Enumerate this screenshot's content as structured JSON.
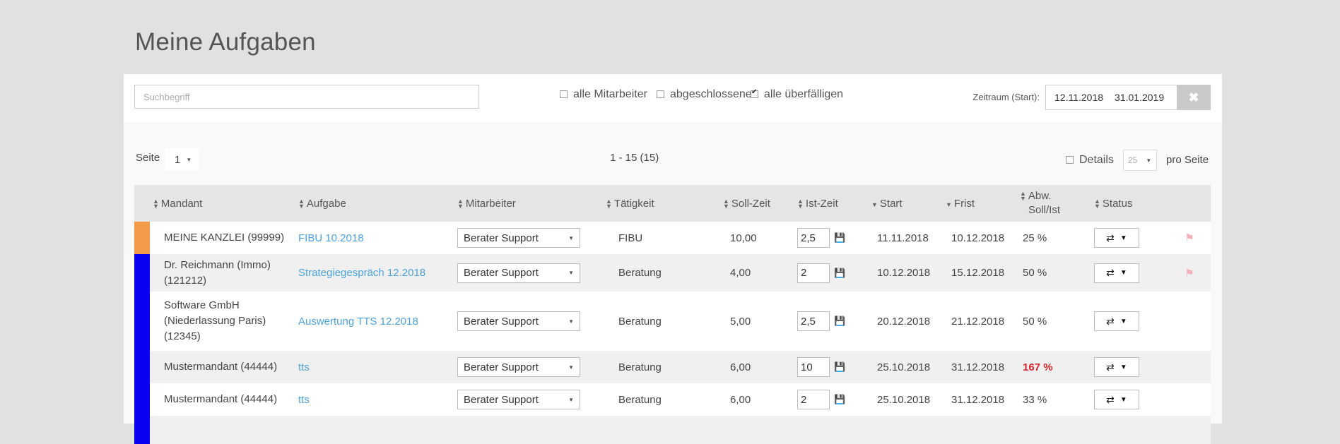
{
  "page": {
    "title": "Meine Aufgaben"
  },
  "filter": {
    "search_placeholder": "Suchbegriff",
    "checkboxes": [
      {
        "label": "alle Mitarbeiter",
        "checked": false
      },
      {
        "label": "abgeschlossene",
        "checked": false
      },
      {
        "label": "alle überfälligen",
        "checked": true
      }
    ],
    "zeitraum_label": "Zeitraum (Start):",
    "date_start": "12.11.2018",
    "date_end": "31.01.2019",
    "clear_icon": "close-icon"
  },
  "pager": {
    "seite_label": "Seite",
    "page": "1",
    "range": "1 - 15 (15)",
    "details_label": "Details",
    "per_page": "25",
    "per_page_label": "pro Seite"
  },
  "table": {
    "headers": {
      "mandant": "Mandant",
      "aufgabe": "Aufgabe",
      "mitarbeiter": "Mitarbeiter",
      "taetigkeit": "Tätigkeit",
      "soll": "Soll-Zeit",
      "ist": "Ist-Zeit",
      "start": "Start",
      "frist": "Frist",
      "abw_line1": "Abw.",
      "abw_line2": "Soll/Ist",
      "status": "Status"
    },
    "rows": [
      {
        "color": "#f59a48",
        "mandant_lines": [
          "MEINE KANZLEI (99999)"
        ],
        "aufgabe": "FIBU 10.2018",
        "mitarbeiter": "Berater Support",
        "taetigkeit": "FIBU",
        "soll": "10,00",
        "ist": "2,5",
        "start": "11.11.2018",
        "frist": "10.12.2018",
        "abw": "25 %",
        "abw_over": false,
        "flag": true
      },
      {
        "color": "#0a00f0",
        "mandant_lines": [
          "Dr. Reichmann (Immo)",
          "(121212)"
        ],
        "aufgabe": "Strategiegespräch 12.2018",
        "mitarbeiter": "Berater Support",
        "taetigkeit": "Beratung",
        "soll": "4,00",
        "ist": "2",
        "start": "10.12.2018",
        "frist": "15.12.2018",
        "abw": "50 %",
        "abw_over": false,
        "flag": true
      },
      {
        "color": "#0a00f0",
        "mandant_lines": [
          "Software GmbH",
          "(Niederlassung Paris)",
          "(12345)"
        ],
        "aufgabe": "Auswertung TTS 12.2018",
        "mitarbeiter": "Berater Support",
        "taetigkeit": "Beratung",
        "soll": "5,00",
        "ist": "2,5",
        "start": "20.12.2018",
        "frist": "21.12.2018",
        "abw": "50 %",
        "abw_over": false,
        "flag": false
      },
      {
        "color": "#0a00f0",
        "mandant_lines": [
          "Mustermandant (44444)"
        ],
        "aufgabe": "tts",
        "mitarbeiter": "Berater Support",
        "taetigkeit": "Beratung",
        "soll": "6,00",
        "ist": "10",
        "start": "25.10.2018",
        "frist": "31.12.2018",
        "abw": "167 %",
        "abw_over": true,
        "flag": false
      },
      {
        "color": "#0a00f0",
        "mandant_lines": [
          "Mustermandant (44444)"
        ],
        "aufgabe": "tts",
        "mitarbeiter": "Berater Support",
        "taetigkeit": "Beratung",
        "soll": "6,00",
        "ist": "2",
        "start": "25.10.2018",
        "frist": "31.12.2018",
        "abw": "33 %",
        "abw_over": false,
        "flag": false
      },
      {
        "color": "#0a00f0",
        "mandant_lines": [
          ""
        ],
        "aufgabe": "",
        "mitarbeiter": "",
        "taetigkeit": "",
        "soll": "",
        "ist": "",
        "start": "",
        "frist": "",
        "abw": "",
        "abw_over": false,
        "flag": false
      }
    ]
  }
}
